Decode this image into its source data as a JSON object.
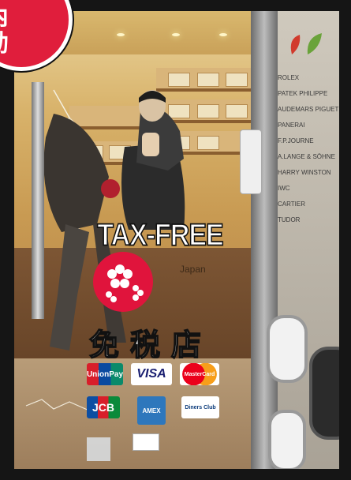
{
  "overlay": {
    "line1": "店內",
    "line2": "搶劫"
  },
  "signage": {
    "tax_free": "TAX-FREE",
    "japan": "Japan",
    "duty_free": "免税店"
  },
  "brands": [
    "ROLEX",
    "PATEK PHILIPPE",
    "AUDEMARS PIGUET",
    "PANERAI",
    "F.P.JOURNE",
    "A.LANGE & SÖHNE",
    "HARRY WINSTON",
    "IWC",
    "CARTIER",
    "TUDOR"
  ],
  "payment_cards": {
    "unionpay": "UnionPay",
    "visa": "VISA",
    "mastercard": "MasterCard",
    "jcb": "JCB",
    "amex": "AMEX",
    "diners": "Diners Club"
  },
  "colors": {
    "badge_red": "#e01e3c",
    "sign_red": "#e0143c",
    "visa_blue": "#1a1f71"
  }
}
